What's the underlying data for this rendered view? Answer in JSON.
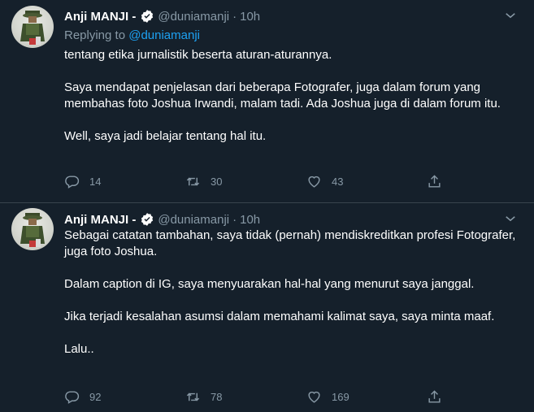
{
  "tweets": [
    {
      "author_name": "Anji MANJI -",
      "handle": "@duniamanji",
      "dot": "·",
      "time": "10h",
      "reply_prefix": "Replying to",
      "reply_handle": "@duniamanji",
      "paragraphs": [
        "tentang etika jurnalistik beserta aturan-aturannya.",
        "Saya mendapat penjelasan dari beberapa Fotografer, juga dalam forum yang membahas foto Joshua Irwandi, malam tadi. Ada Joshua juga di dalam forum itu.",
        "Well, saya jadi belajar tentang hal itu."
      ],
      "reply_count": "14",
      "retweet_count": "30",
      "like_count": "43"
    },
    {
      "author_name": "Anji MANJI -",
      "handle": "@duniamanji",
      "dot": "·",
      "time": "10h",
      "paragraphs": [
        "Sebagai catatan tambahan, saya tidak (pernah) mendiskreditkan profesi Fotografer, juga foto Joshua.",
        "Dalam caption di IG, saya menyuarakan hal-hal yang menurut saya janggal.",
        "Jika terjadi kesalahan asumsi dalam memahami kalimat saya, saya minta maaf.",
        "Lalu.."
      ],
      "reply_count": "92",
      "retweet_count": "78",
      "like_count": "169"
    }
  ],
  "icons": {
    "verified": "verified-badge-icon",
    "caret": "chevron-down-icon",
    "reply": "reply-icon",
    "retweet": "retweet-icon",
    "like": "heart-icon",
    "share": "share-icon"
  },
  "colors": {
    "background": "#15202b",
    "secondary_text": "#8899a6",
    "link": "#1da1f2",
    "divider": "#38444d"
  }
}
